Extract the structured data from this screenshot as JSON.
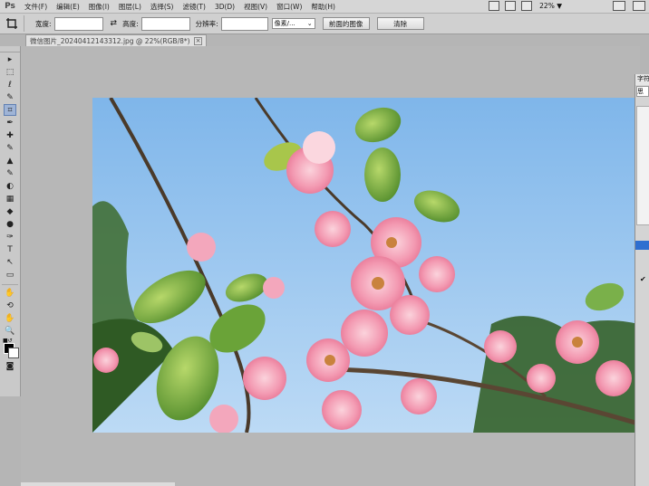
{
  "app": {
    "logo": "Ps"
  },
  "menu": {
    "items": [
      "文件(F)",
      "编辑(E)",
      "图像(I)",
      "图层(L)",
      "选择(S)",
      "滤镜(T)",
      "3D(D)",
      "视图(V)",
      "窗口(W)",
      "帮助(H)"
    ],
    "zoom": "22%",
    "zoom_arrow": "▼"
  },
  "options": {
    "width_label": "宽度:",
    "swap_symbol": "⇄",
    "height_label": "高度:",
    "resolution_label": "分辨率:",
    "unit_select": "像素/...",
    "front_image_button": "前面的图像",
    "clear_button": "清除"
  },
  "document": {
    "tab_title": "微信图片_20240412143312.jpg @ 22%(RGB/8*)",
    "close": "×"
  },
  "tools": [
    "▸",
    "⬚",
    "ℓ",
    "✎",
    "⌗",
    "✒",
    "✚",
    "✎",
    "▲",
    "✎",
    "◐",
    "▦",
    "◆",
    "●",
    "✑",
    "T",
    "↖",
    "▭",
    "✋",
    "⟲",
    "✋",
    "🔍"
  ],
  "right_panel": {
    "title": "字符",
    "field": "思"
  },
  "colors": {
    "sky": "#8fc0ec",
    "blossom": "#f29bb3",
    "leaf": "#6fa53a",
    "accent_blue": "#2f6fd0"
  }
}
